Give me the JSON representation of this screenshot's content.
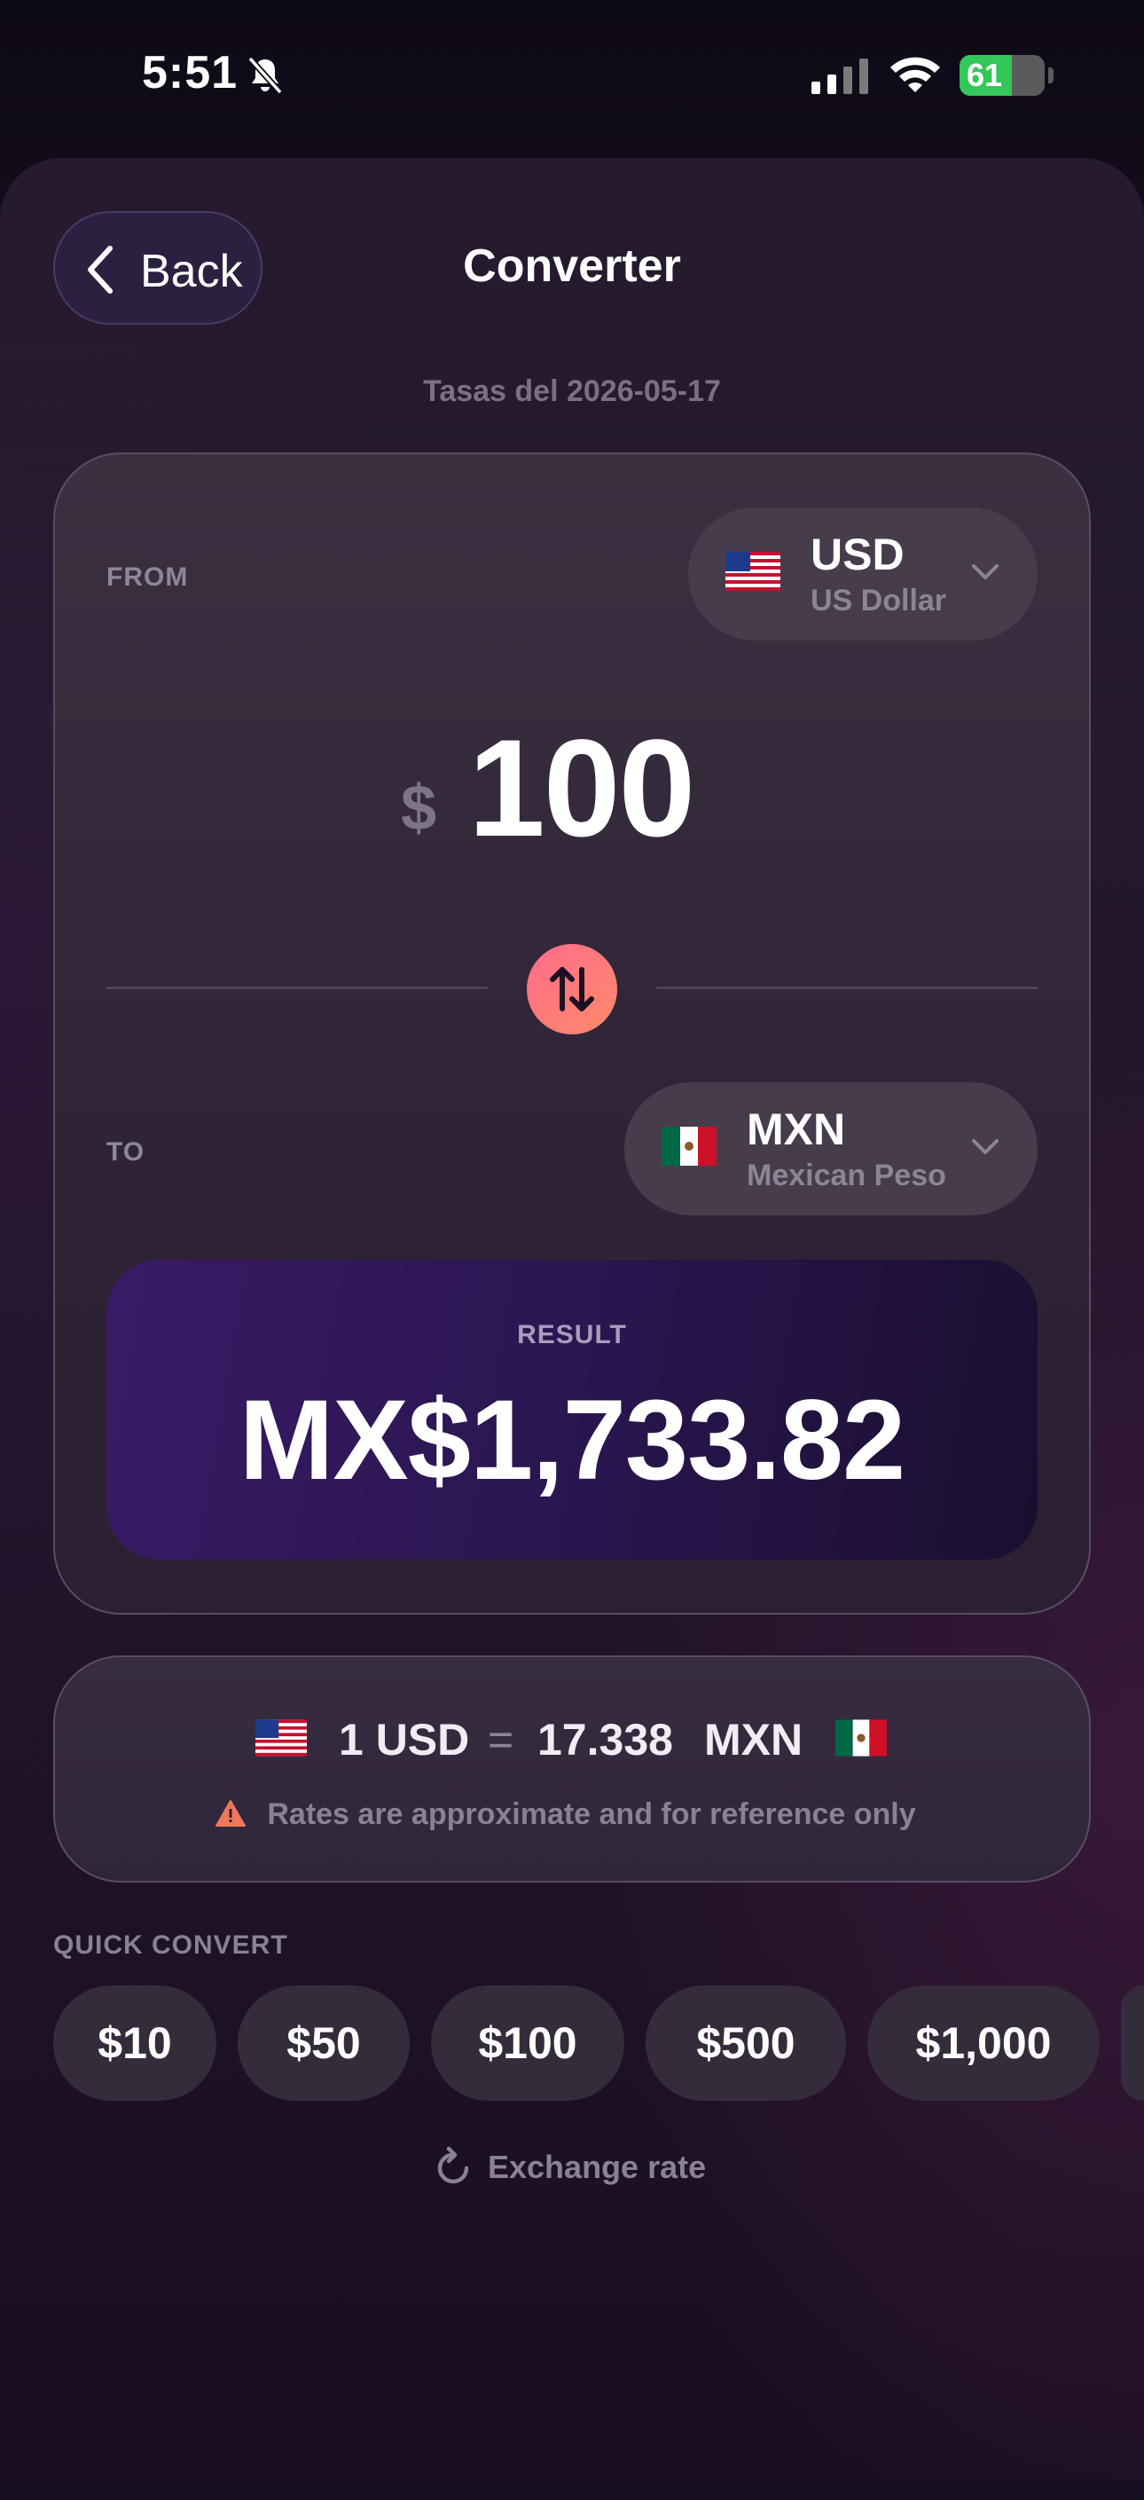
{
  "status_bar": {
    "time": "5:51",
    "battery": "61",
    "battery_level": 0.61
  },
  "header": {
    "back_label": "Back",
    "title": "Converter"
  },
  "rates_date": "Tasas del 2026-05-17",
  "from": {
    "label": "FROM",
    "code": "USD",
    "name": "US Dollar",
    "flag_icon": "us-flag-icon",
    "symbol": "$",
    "amount": "100"
  },
  "to": {
    "label": "TO",
    "code": "MXN",
    "name": "Mexican Peso",
    "flag_icon": "mexico-flag-icon"
  },
  "result": {
    "label": "RESULT",
    "value": "MX$1,733.82"
  },
  "rate": {
    "left": "1 USD",
    "equals": "=",
    "value": "17.338",
    "right_code": "MXN",
    "warning": "Rates are approximate and for reference only"
  },
  "quick_convert": {
    "label": "QUICK CONVERT",
    "chips": [
      "$10",
      "$50",
      "$100",
      "$500",
      "$1,000"
    ]
  },
  "refresh_label": "Exchange rate",
  "colors": {
    "accent_gradient_start": "#ff6b8a",
    "accent_gradient_end": "#ff8a6a",
    "result_bg": "#2a1650",
    "battery_green": "#34c759"
  }
}
